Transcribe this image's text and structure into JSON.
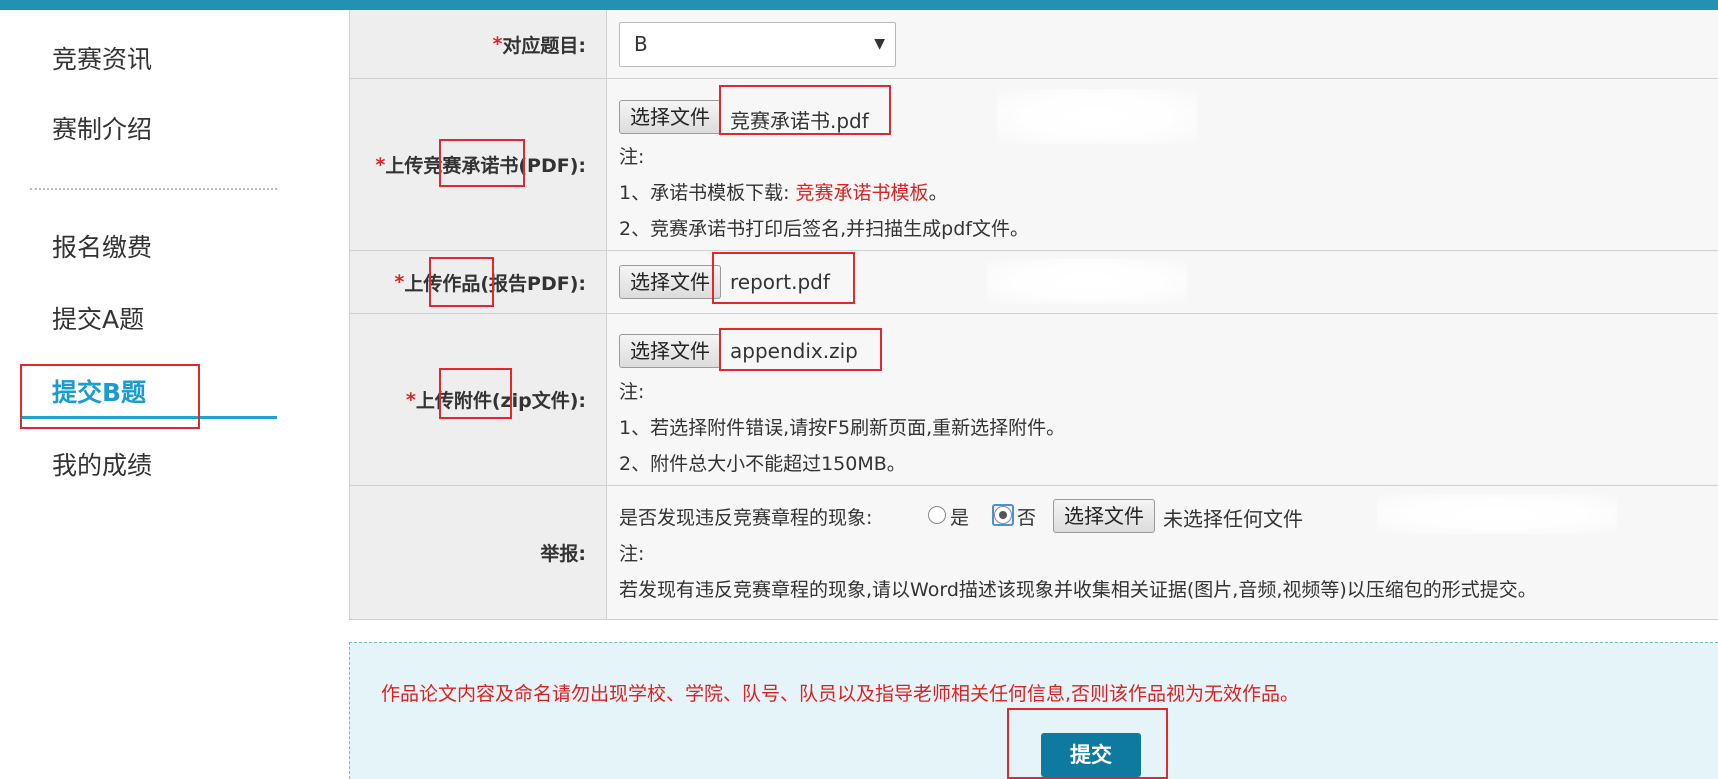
{
  "sidebar": {
    "items": [
      {
        "label": "竞赛资讯"
      },
      {
        "label": "赛制介绍"
      },
      {
        "label": "报名缴费"
      },
      {
        "label": "提交A题"
      },
      {
        "label": "提交B题"
      },
      {
        "label": "我的成绩"
      }
    ],
    "active_index": 4
  },
  "form": {
    "topic": {
      "required_mark": "*",
      "label": "对应题目:",
      "selected": "B",
      "caret": "▼"
    },
    "pledge": {
      "required_mark": "*",
      "label": "上传竞赛承诺书(PDF):",
      "button": "选择文件",
      "file": "竞赛承诺书.pdf",
      "note_title": "注:",
      "note1_prefix": "1、承诺书模板下载:",
      "note1_link": "竞赛承诺书模板",
      "note1_suffix": "。",
      "note2": "2、竞赛承诺书打印后签名,并扫描生成pdf文件。"
    },
    "report": {
      "required_mark": "*",
      "label": "上传作品(报告PDF):",
      "button": "选择文件",
      "file": "report.pdf"
    },
    "attachment": {
      "required_mark": "*",
      "label": "上传附件(zip文件):",
      "button": "选择文件",
      "file": "appendix.zip",
      "note_title": "注:",
      "note1": "1、若选择附件错误,请按F5刷新页面,重新选择附件。",
      "note2": "2、附件总大小不能超过150MB。"
    },
    "report_issue": {
      "label": "举报:",
      "question": "是否发现违反竞赛章程的现象:",
      "yes": "是",
      "no": "否",
      "selected": "否",
      "button": "选择文件",
      "file": "未选择任何文件",
      "note_title": "注:",
      "note": "若发现有违反竞赛章程的现象,请以Word描述该现象并收集相关证据(图片,音频,视频等)以压缩包的形式提交。"
    }
  },
  "notice": {
    "warning": "作品论文内容及命名请勿出现学校、学院、队号、队员以及指导老师相关任何信息,否则该作品视为无效作品。",
    "submit": "提交"
  },
  "colors": {
    "accent": "#2391b2",
    "active": "#1a9bd1",
    "required": "#e02020",
    "submit": "#0f7aa0",
    "annotation": "#e0282e"
  }
}
